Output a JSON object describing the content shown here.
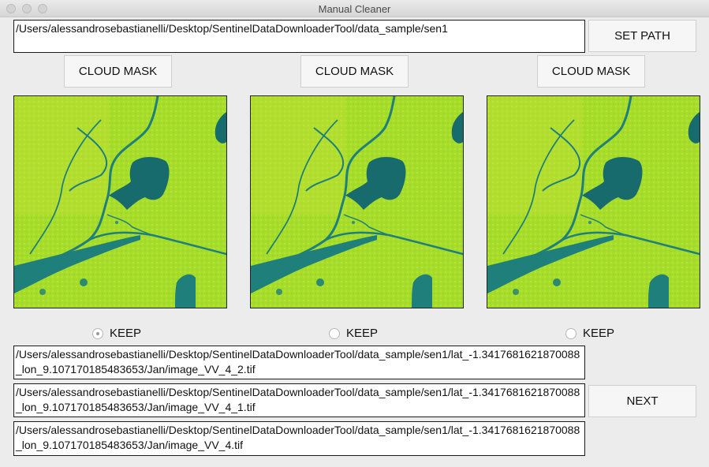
{
  "window": {
    "title": "Manual Cleaner"
  },
  "path": {
    "value": "/Users/alessandrosebastianelli/Desktop/SentinelDataDownloaderTool/data_sample/sen1",
    "set_path_label": "SET PATH"
  },
  "panels": [
    {
      "cloud_mask_label": "CLOUD MASK",
      "keep_label": "KEEP",
      "keep_checked": true,
      "file_path": "/Users/alessandrosebastianelli/Desktop/SentinelDataDownloaderTool/data_sample/sen1/lat_-1.3417681621870088_lon_9.107170185483653/Jan/image_VV_4_2.tif"
    },
    {
      "cloud_mask_label": "CLOUD MASK",
      "keep_label": "KEEP",
      "keep_checked": false,
      "file_path": "/Users/alessandrosebastianelli/Desktop/SentinelDataDownloaderTool/data_sample/sen1/lat_-1.3417681621870088_lon_9.107170185483653/Jan/image_VV_4_1.tif"
    },
    {
      "cloud_mask_label": "CLOUD MASK",
      "keep_label": "KEEP",
      "keep_checked": false,
      "file_path": "/Users/alessandrosebastianelli/Desktop/SentinelDataDownloaderTool/data_sample/sen1/lat_-1.3417681621870088_lon_9.107170185483653/Jan/image_VV_4.tif"
    }
  ],
  "next_label": "NEXT",
  "colors": {
    "land": "#a6dc2a",
    "land_light": "#c8e638",
    "water": "#1f7f7a",
    "water_dark": "#176b6d"
  }
}
